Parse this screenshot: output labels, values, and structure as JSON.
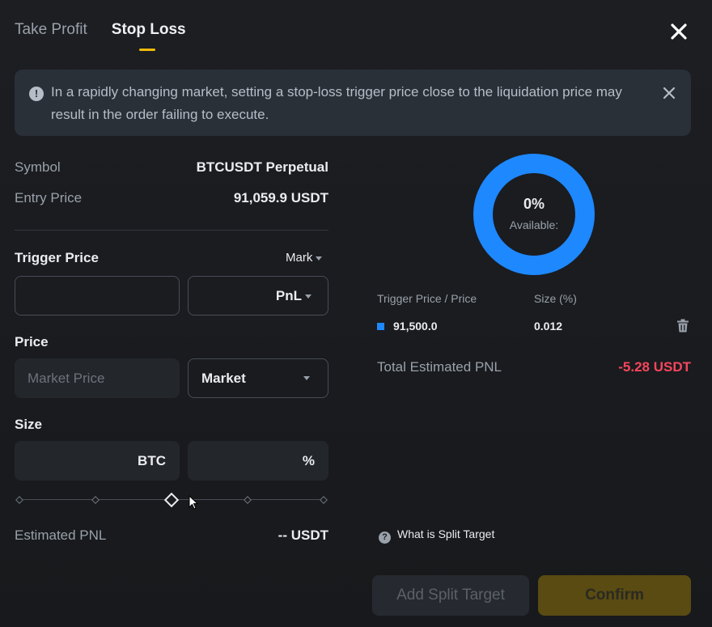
{
  "tabs": [
    {
      "label": "Take Profit",
      "active": false
    },
    {
      "label": "Stop Loss",
      "active": true
    }
  ],
  "banner": {
    "text": "In a rapidly changing market, setting a stop-loss trigger price close to the liquidation price may result in the order failing to execute."
  },
  "info": {
    "symbol_label": "Symbol",
    "symbol_value": "BTCUSDT Perpetual",
    "entry_label": "Entry Price",
    "entry_value": "91,059.9 USDT"
  },
  "trigger": {
    "title": "Trigger Price",
    "type_select": "Mark",
    "value": "",
    "unit_select": "PnL"
  },
  "price": {
    "title": "Price",
    "placeholder": "Market Price",
    "type_select": "Market"
  },
  "size": {
    "title": "Size",
    "unit_base": "BTC",
    "unit_pct": "%",
    "slider_percent": 50
  },
  "estimated": {
    "label": "Estimated PNL",
    "value": "-- USDT"
  },
  "donut": {
    "percent": "0%",
    "label": "Available:",
    "ring_color": "#1e88ff"
  },
  "targets": {
    "col_price": "Trigger Price / Price",
    "col_size": "Size (%)",
    "rows": [
      {
        "price": "91,500.0",
        "size": "0.012"
      }
    ],
    "total_label": "Total Estimated PNL",
    "total_value": "-5.28 USDT",
    "total_color": "#f6465d"
  },
  "footer": {
    "help": "What is Split Target",
    "add_split": "Add Split Target",
    "confirm": "Confirm"
  }
}
